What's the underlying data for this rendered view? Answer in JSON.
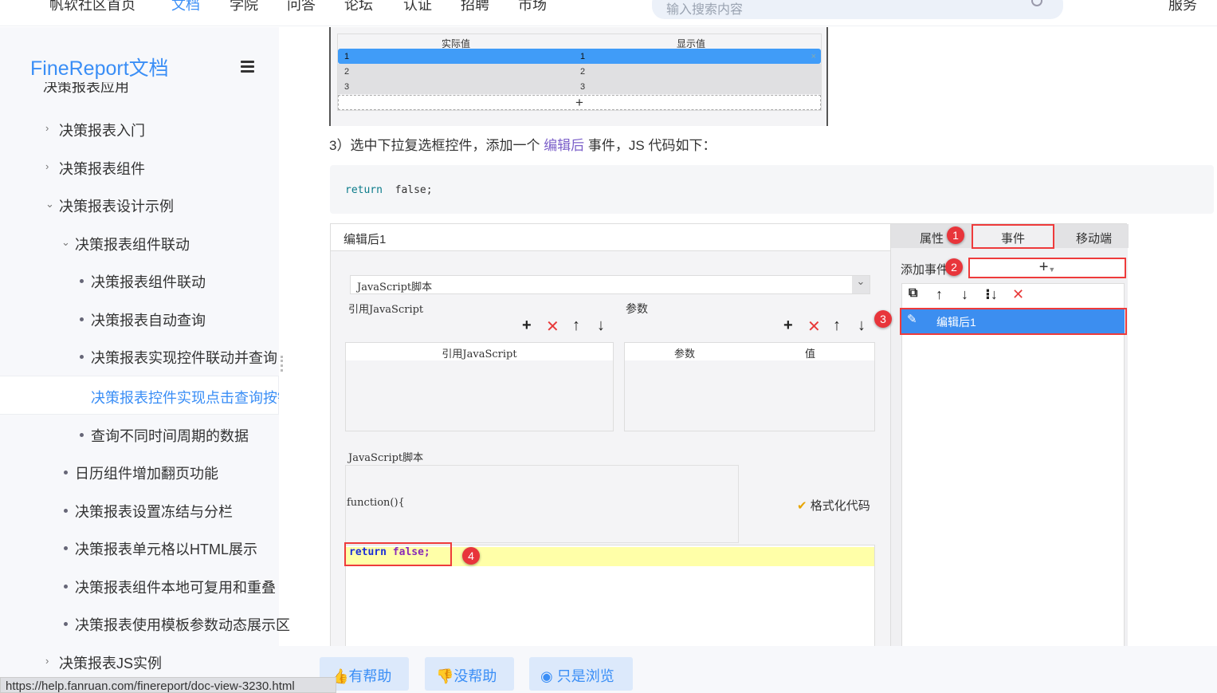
{
  "nav": {
    "items": [
      "帆软社区首页",
      "文档",
      "学院",
      "问答",
      "论坛",
      "认证",
      "招聘",
      "市场"
    ],
    "active": 1,
    "right": "服务"
  },
  "search": {
    "placeholder": "输入搜索内容"
  },
  "sidebar": {
    "logo": "FineReport文档",
    "partial": "决策报表应用",
    "items": [
      {
        "label": "决策报表入门",
        "type": "chev-right",
        "level": 1
      },
      {
        "label": "决策报表组件",
        "type": "chev-right",
        "level": 1
      },
      {
        "label": "决策报表设计示例",
        "type": "chev-down",
        "level": 1
      },
      {
        "label": "决策报表组件联动",
        "type": "chev-down",
        "level": 2
      },
      {
        "label": "决策报表组件联动",
        "type": "bullet",
        "level": 3
      },
      {
        "label": "决策报表自动查询",
        "type": "bullet",
        "level": 3
      },
      {
        "label": "决策报表实现控件联动并查询",
        "type": "bullet",
        "level": 3
      },
      {
        "label": "决策报表控件实现点击查询按钮",
        "type": "bullet",
        "level": 3,
        "active": true
      },
      {
        "label": "查询不同时间周期的数据",
        "type": "bullet",
        "level": 3
      },
      {
        "label": "日历组件增加翻页功能",
        "type": "bullet",
        "level": 2
      },
      {
        "label": "决策报表设置冻结与分栏",
        "type": "bullet",
        "level": 2
      },
      {
        "label": "决策报表单元格以HTML展示",
        "type": "bullet",
        "level": 2
      },
      {
        "label": "决策报表组件本地可复用和重叠",
        "type": "bullet",
        "level": 2
      },
      {
        "label": "决策报表使用模板参数动态展示区",
        "type": "bullet",
        "level": 2
      },
      {
        "label": "决策报表JS实例",
        "type": "chev-right",
        "level": 1
      }
    ]
  },
  "table1": {
    "headers": [
      "实际值",
      "显示值"
    ],
    "rows": [
      [
        "1",
        "1"
      ],
      [
        "2",
        "2"
      ],
      [
        "3",
        "3"
      ]
    ],
    "add": "+"
  },
  "step3": {
    "before": "3）选中下拉复选框控件，添加一个 ",
    "link": "编辑后",
    "after": " 事件，JS 代码如下："
  },
  "code": {
    "kw": "return",
    "rest": "  false;"
  },
  "dialog": {
    "title": "编辑后1",
    "type": "JavaScript脚本",
    "ref_label": "引用JavaScript",
    "param_label": "参数",
    "ref_header": "引用JavaScript",
    "param_headers": [
      "参数",
      "值"
    ],
    "script_label": "JavaScript脚本",
    "func": "function(){",
    "format": "格式化代码",
    "ret_kw": "return",
    "ret_val": "false;",
    "tabs": [
      "属性",
      "事件",
      "移动端"
    ],
    "add_event": "添加事件",
    "event_item": "编辑后1",
    "badges": [
      "1",
      "2",
      "3",
      "4"
    ]
  },
  "footer": {
    "helpful": "有帮助",
    "not_helpful": "没帮助",
    "just_browsing": "只是浏览"
  },
  "status_url": "https://help.fanruan.com/finereport/doc-view-3230.html"
}
